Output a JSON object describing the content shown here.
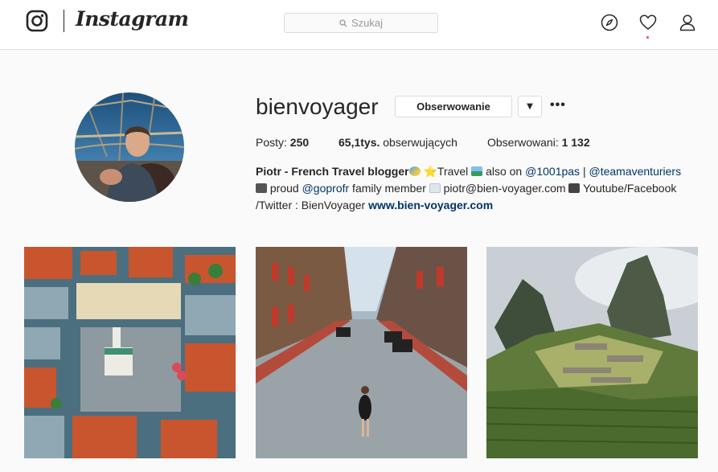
{
  "header": {
    "brand": "Instagram",
    "search_placeholder": "Szukaj"
  },
  "profile": {
    "username": "bienvoyager",
    "follow_label": "Obserwowanie",
    "dropdown_glyph": "▼",
    "more_glyph": "•••",
    "stats": {
      "posts_label": "Posty:",
      "posts_value": "250",
      "followers_value": "65,1tys.",
      "followers_label": "obserwujących",
      "following_label": "Obserwowani:",
      "following_value": "1 132"
    },
    "bio": {
      "name": "Piotr - French Travel blogger",
      "line1_a": " ⭐Travel ",
      "line1_b": " also on ",
      "mention1": "@1001pas",
      "line1_c": " | ",
      "mention2": "@teamaventuriers",
      "line2_a": " proud ",
      "mention3": "@goprofr",
      "line2_b": " family member ",
      "line2_c": " piotr@bien-voyager.com ",
      "line2_d": " Youtube/Facebook",
      "line3": "/Twitter : BienVoyager ",
      "website": "www.bien-voyager.com"
    }
  },
  "icons": {
    "logo": "instagram-camera-icon",
    "search": "search-icon",
    "explore": "compass-icon",
    "activity": "heart-icon",
    "profile": "person-icon"
  },
  "colors": {
    "link": "#003569",
    "notification": "#ed4956",
    "border": "#dbdbdb"
  }
}
